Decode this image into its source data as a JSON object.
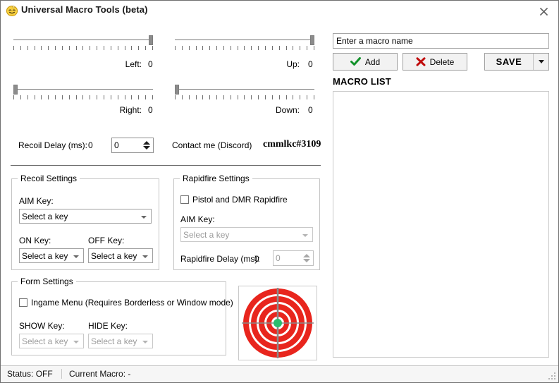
{
  "window": {
    "title": "Universal Macro Tools (beta)",
    "icon": "smiley-face-icon",
    "close_label": "✖"
  },
  "sliders": [
    {
      "name": "left",
      "label": "Left:",
      "value": "0",
      "thumb_percent": 100
    },
    {
      "name": "up",
      "label": "Up:",
      "value": "0",
      "thumb_percent": 100
    },
    {
      "name": "right",
      "label": "Right:",
      "value": "0",
      "thumb_percent": 0
    },
    {
      "name": "down",
      "label": "Down:",
      "value": "0",
      "thumb_percent": 0
    }
  ],
  "recoil_delay": {
    "label": "Recoil Delay (ms):",
    "display_value": "0",
    "spinner_value": "0"
  },
  "contact": {
    "label": "Contact me (Discord)",
    "tag": "cmmlkc#3109"
  },
  "recoil_settings": {
    "legend": "Recoil Settings",
    "aim_key_label": "AIM Key:",
    "aim_key_value": "Select a key",
    "on_key_label": "ON Key:",
    "on_key_value": "Select a key",
    "off_key_label": "OFF Key:",
    "off_key_value": "Select a key"
  },
  "rapidfire_settings": {
    "legend": "Rapidfire Settings",
    "checkbox_label": "Pistol and DMR Rapidfire",
    "checkbox_checked": false,
    "aim_key_label": "AIM Key:",
    "aim_key_value": "Select a key",
    "delay_label": "Rapidfire Delay (ms):",
    "delay_display_value": "0",
    "delay_spinner_value": "0"
  },
  "form_settings": {
    "legend": "Form Settings",
    "checkbox_label": "Ingame Menu (Requires Borderless or Window mode)",
    "checkbox_checked": false,
    "show_key_label": "SHOW Key:",
    "show_key_value": "Select a key",
    "hide_key_label": "HIDE Key:",
    "hide_key_value": "Select a key"
  },
  "target_image": {
    "name": "bullseye-target-image",
    "ring_color": "#e8251d",
    "center_color": "#2bbd6e",
    "crosshair_color": "#8a8a8a"
  },
  "macro_panel": {
    "name_input_value": "Enter a macro name",
    "name_input_placeholder": "Enter a macro name",
    "add_label": "Add",
    "add_icon": "green-check-icon",
    "delete_label": "Delete",
    "delete_icon": "red-x-icon",
    "save_label": "SAVE",
    "list_title": "MACRO LIST",
    "list_items": []
  },
  "statusbar": {
    "status": "Status: OFF",
    "current_macro": "Current Macro: -"
  },
  "colors": {
    "accent_red": "#e8251d",
    "accent_green": "#2bbd6e",
    "border": "#c4c4c4"
  }
}
